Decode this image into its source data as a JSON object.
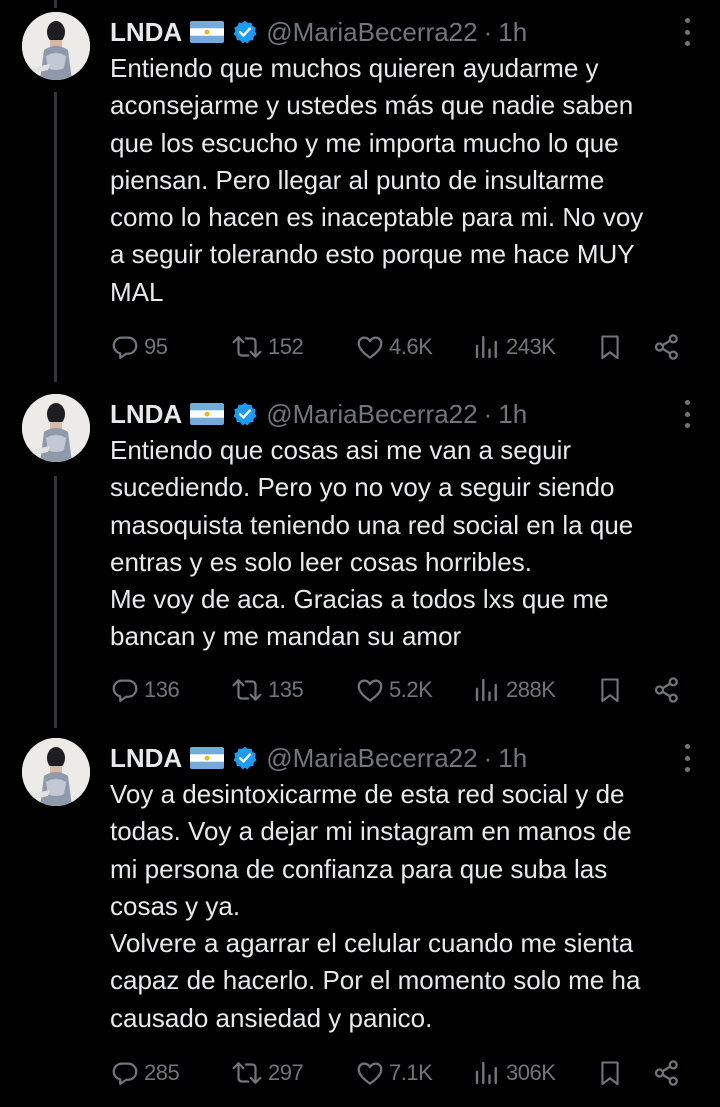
{
  "colors": {
    "background": "#000000",
    "text": "#e7e9ea",
    "muted": "#71767b",
    "verified": "#1d9bf0",
    "thread_line": "#333639"
  },
  "tweets": [
    {
      "name": "LNDA",
      "flag": "argentina-flag-emoji",
      "verified": "verified-badge-icon",
      "handle": "@MariaBecerra22",
      "separator": "·",
      "time": "1h",
      "lines": [
        "Entiendo que muchos quieren ayudarme y",
        "aconsejarme y ustedes más que nadie saben",
        "que los escucho y me importa mucho lo que",
        "piensan. Pero llegar al punto de insultarme",
        "como lo hacen es inaceptable para mi. No voy",
        "a seguir tolerando esto porque me hace MUY",
        "MAL"
      ],
      "stats": {
        "replies": "95",
        "reposts": "152",
        "likes": "4.6K",
        "views": "243K"
      }
    },
    {
      "name": "LNDA",
      "flag": "argentina-flag-emoji",
      "verified": "verified-badge-icon",
      "handle": "@MariaBecerra22",
      "separator": "·",
      "time": "1h",
      "lines": [
        "Entiendo que cosas asi me van a seguir",
        "sucediendo. Pero yo no voy a seguir siendo",
        "masoquista teniendo una red social en la que",
        "entras y es solo leer cosas horribles.",
        "Me voy de aca. Gracias a todos lxs que me",
        "bancan y me mandan su amor"
      ],
      "stats": {
        "replies": "136",
        "reposts": "135",
        "likes": "5.2K",
        "views": "288K"
      }
    },
    {
      "name": "LNDA",
      "flag": "argentina-flag-emoji",
      "verified": "verified-badge-icon",
      "handle": "@MariaBecerra22",
      "separator": "·",
      "time": "1h",
      "lines": [
        "Voy a desintoxicarme de esta red social y de",
        "todas. Voy a dejar mi instagram en manos de",
        "mi persona de confianza para que suba las",
        "cosas y ya.",
        "Volvere a agarrar el celular cuando me sienta",
        "capaz de hacerlo. Por el momento solo me ha",
        "causado ansiedad y panico."
      ],
      "stats": {
        "replies": "285",
        "reposts": "297",
        "likes": "7.1K",
        "views": "306K"
      }
    }
  ]
}
